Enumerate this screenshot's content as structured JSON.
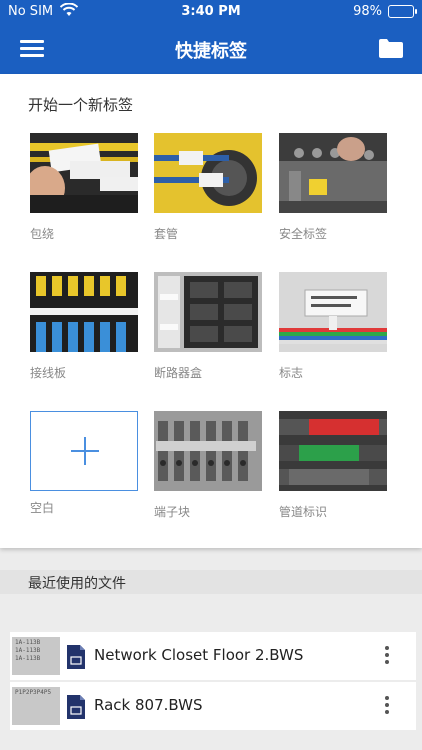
{
  "status_bar": {
    "carrier": "No SIM",
    "time": "3:40 PM",
    "battery": "98%",
    "battery_level": 0.98
  },
  "navbar": {
    "title": "快捷标签",
    "menu_icon": "hamburger-menu-icon",
    "folder_icon": "folder-icon"
  },
  "start_section": {
    "heading": "开始一个新标签",
    "tiles": [
      {
        "label": "包绕"
      },
      {
        "label": "套管"
      },
      {
        "label": "安全标签"
      },
      {
        "label": "接线板"
      },
      {
        "label": "断路器盒"
      },
      {
        "label": "标志"
      },
      {
        "label": "空白"
      },
      {
        "label": "端子块"
      },
      {
        "label": "管道标识"
      }
    ]
  },
  "recent": {
    "heading": "最近使用的文件",
    "files": [
      {
        "name": "Network Closet Floor 2.BWS",
        "preview_lines": [
          "1A-113B",
          "1A-113B",
          "1A-113B"
        ]
      },
      {
        "name": "Rack 807.BWS",
        "preview_lines": [
          "P1P2P3P4P5"
        ]
      }
    ]
  },
  "colors": {
    "brand_blue": "#1b5fc1",
    "accent_blue": "#4a8fe0"
  }
}
